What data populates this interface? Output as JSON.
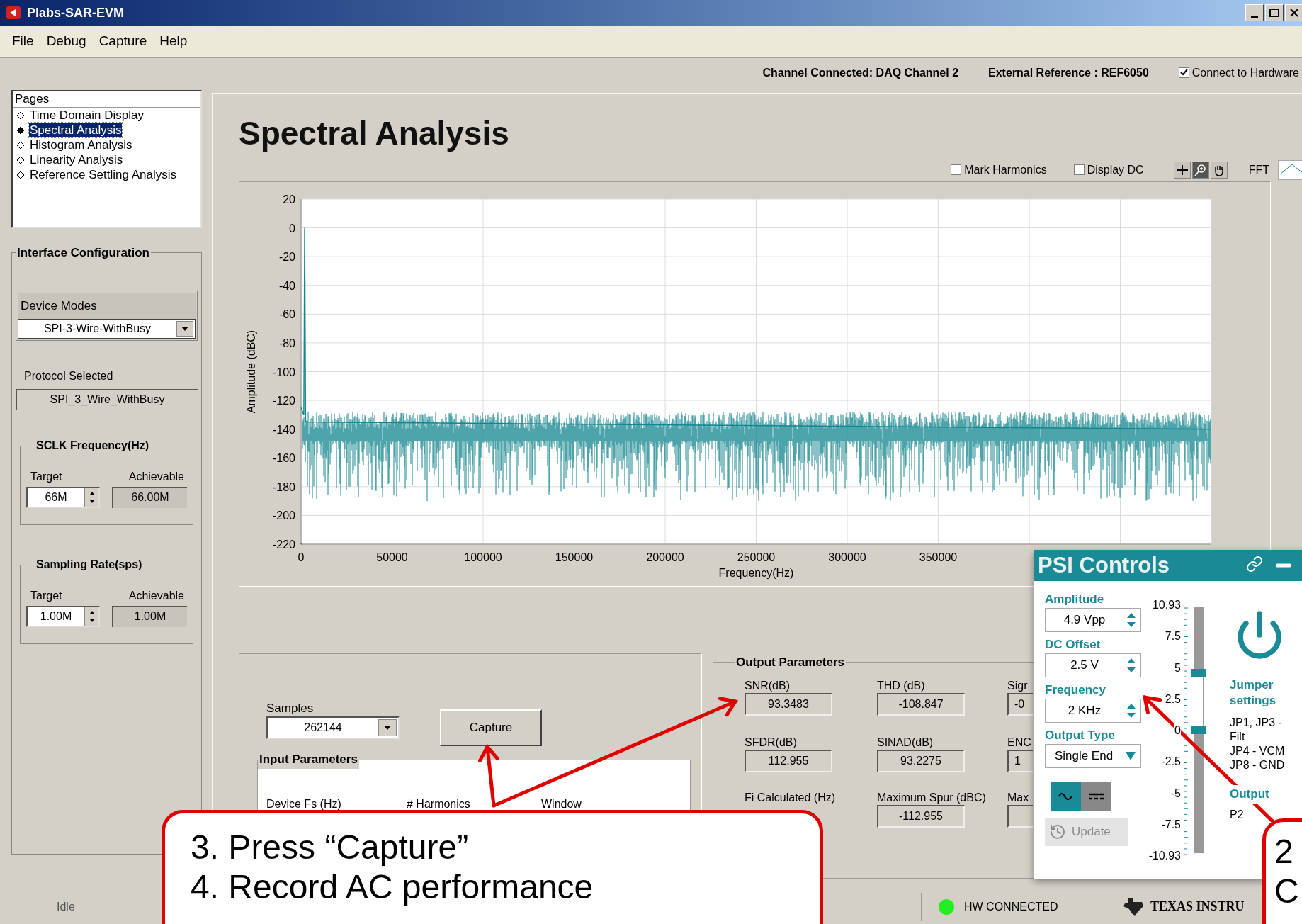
{
  "window": {
    "title": "Plabs-SAR-EVM"
  },
  "menu": [
    "File",
    "Debug",
    "Capture",
    "Help"
  ],
  "info_bar": {
    "channel": "Channel Connected: DAQ Channel 2",
    "reference": "External Reference : REF6050",
    "connect": {
      "label": "Connect to Hardware",
      "checked": true
    }
  },
  "pages": {
    "title": "Pages",
    "items": [
      {
        "label": "Time Domain Display",
        "selected": false
      },
      {
        "label": "Spectral Analysis",
        "selected": true
      },
      {
        "label": "Histogram Analysis",
        "selected": false
      },
      {
        "label": "Linearity Analysis",
        "selected": false
      },
      {
        "label": "Reference Settling Analysis",
        "selected": false
      }
    ]
  },
  "interface": {
    "title": "Interface Configuration",
    "device_modes": {
      "label": "Device Modes",
      "value": "SPI-3-Wire-WithBusy"
    },
    "protocol": {
      "label": "Protocol Selected",
      "value": "SPI_3_Wire_WithBusy"
    },
    "groups": [
      {
        "title": "SCLK Frequency(Hz)",
        "target_label": "Target",
        "target": "66M",
        "achievable_label": "Achievable",
        "achievable": "66.00M"
      },
      {
        "title": "Sampling Rate(sps)",
        "target_label": "Target",
        "target": "1.00M",
        "achievable_label": "Achievable",
        "achievable": "1.00M"
      }
    ]
  },
  "page_title": "Spectral Analysis",
  "chart_options": [
    {
      "label": "Mark Harmonics",
      "checked": false
    },
    {
      "label": "Display DC",
      "checked": false
    }
  ],
  "chart_tools": [
    {
      "kind": "cursor",
      "selected": false
    },
    {
      "kind": "zoom",
      "selected": true
    },
    {
      "kind": "pan",
      "selected": false
    }
  ],
  "spectrum": {
    "chart_data": {
      "type": "line",
      "grid": true,
      "xlabel": "Frequency(Hz)",
      "ylabel": "Amplitude (dBC)",
      "xlim": [
        0,
        500000
      ],
      "ylim": [
        -220,
        20
      ],
      "xticks": [
        0,
        50000,
        100000,
        150000,
        200000,
        250000,
        300000,
        350000
      ],
      "yticks": [
        20,
        0,
        -20,
        -40,
        -60,
        -80,
        -100,
        -120,
        -140,
        -160,
        -180,
        -200,
        -220
      ],
      "x": [
        0,
        1500,
        2000,
        2500,
        500000
      ],
      "series": [
        {
          "name": "FFT",
          "color": "#12868f",
          "values": [
            -125,
            -130,
            0,
            -135,
            -140
          ]
        }
      ]
    }
  },
  "capture": {
    "samples_label": "Samples",
    "samples": "262144",
    "button": "Capture",
    "input_title": "Input Parameters",
    "input_labels": [
      "Device Fs (Hz)",
      "# Harmonics",
      "Window"
    ]
  },
  "output": {
    "title": "Output Parameters",
    "fields": [
      {
        "label": "SNR(dB)",
        "value": "93.3483"
      },
      {
        "label": "THD (dB)",
        "value": "-108.847"
      },
      {
        "label": "Sigr",
        "value": "-0"
      },
      {
        "label": "SFDR(dB)",
        "value": "112.955"
      },
      {
        "label": "SINAD(dB)",
        "value": "93.2275"
      },
      {
        "label": "ENC",
        "value": "1"
      },
      {
        "label": "Fi Calculated (Hz)"
      },
      {
        "label": "Maximum Spur (dBC)",
        "value": "-112.955"
      },
      {
        "label": "Max"
      }
    ]
  },
  "psi": {
    "title": "PSI Controls",
    "fields": [
      {
        "label": "Amplitude",
        "value": "4.9 Vpp",
        "kind": "spinner"
      },
      {
        "label": "DC Offset",
        "value": "2.5 V",
        "kind": "spinner"
      },
      {
        "label": "Frequency",
        "value": "2 KHz",
        "kind": "spinner"
      },
      {
        "label": "Output Type",
        "value": "Single End",
        "kind": "dropdown"
      }
    ],
    "wave_modes": [
      {
        "kind": "sine",
        "selected": true
      },
      {
        "kind": "dc",
        "selected": false
      }
    ],
    "update": {
      "label": "Update",
      "disabled": true
    },
    "scale": [
      "10.93",
      "7.5",
      "5",
      "2.5",
      "0",
      "-2.5",
      "-5",
      "-7.5",
      "-10.93"
    ],
    "thumbs": [
      {
        "level": 0.729
      },
      {
        "level": 0.5
      }
    ],
    "jumper_title": "Jumper settings",
    "jumper_lines": [
      "JP1, JP3 -",
      "Filt",
      "JP4 - VCM",
      "JP8 - GND"
    ],
    "output_title": "Output",
    "output_value": "P2"
  },
  "status_bar": {
    "state": "Idle",
    "hw": "HW CONNECTED",
    "hw_connected": true,
    "logo": "TEXAS INSTRU"
  },
  "callouts": [
    {
      "lines": [
        "3. Press “Capture”",
        "4. Record AC performance"
      ]
    },
    {
      "lines": [
        "2",
        "C"
      ]
    }
  ]
}
